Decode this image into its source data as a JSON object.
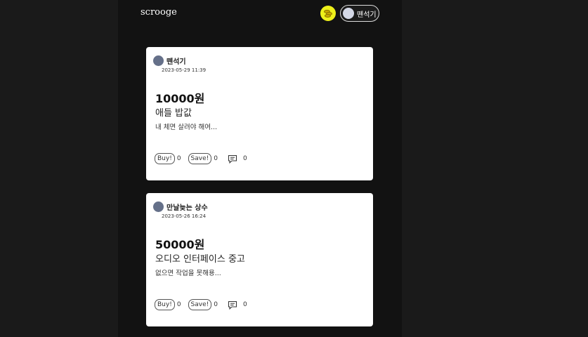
{
  "header": {
    "logo": "scrooge",
    "icon": "coins-icon",
    "user_name": "뗀석기"
  },
  "posts": [
    {
      "author": "뗀석기",
      "timestamp": "2023-05-29 11:39",
      "price": "10000원",
      "title": "애들 밥값",
      "description": "내 체면 살려야 해여...",
      "buy_label": "Buy!",
      "buy_count": "0",
      "save_label": "Save!",
      "save_count": "0",
      "comment_count": "0"
    },
    {
      "author": "만날늦는 상수",
      "timestamp": "2023-05-26 16:24",
      "price": "50000원",
      "title": "오디오 인터페이스 중고",
      "description": "없으면 작업을 못해용...",
      "buy_label": "Buy!",
      "buy_count": "0",
      "save_label": "Save!",
      "save_count": "0",
      "comment_count": "0"
    }
  ],
  "colors": {
    "background": "#1a1a1a",
    "panel": "#121212",
    "accent_yellow": "#eef01a",
    "avatar": "#657089"
  }
}
